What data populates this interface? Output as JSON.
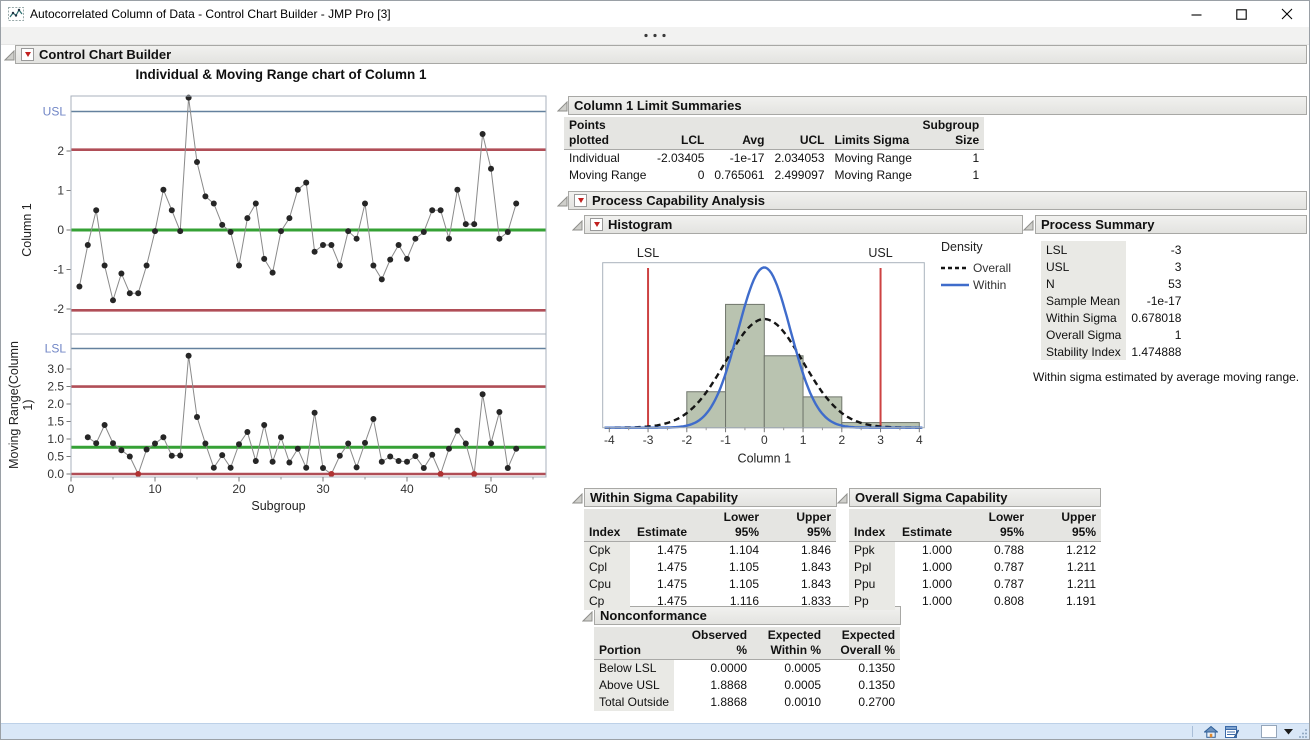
{
  "window": {
    "title": "Autocorrelated Column of Data - Control Chart Builder - JMP Pro [3]"
  },
  "toolbar": {
    "overflow_icon": "ellipsis-dots"
  },
  "outlines": {
    "control_chart_builder": {
      "label": "Control Chart Builder",
      "red_triangle": true
    },
    "limit_summaries": {
      "label": "Column 1 Limit Summaries",
      "red_triangle": false
    },
    "process_capability": {
      "label": "Process Capability Analysis",
      "red_triangle": true
    },
    "histogram": {
      "label": "Histogram",
      "red_triangle": true
    },
    "process_summary": {
      "label": "Process Summary",
      "red_triangle": false
    },
    "within_sigma": {
      "label": "Within Sigma Capability",
      "red_triangle": false
    },
    "overall_sigma": {
      "label": "Overall Sigma Capability",
      "red_triangle": false
    },
    "nonconformance": {
      "label": "Nonconformance",
      "red_triangle": false
    }
  },
  "colors": {
    "center_line_green": "#35a135",
    "control_limit_red": "#b04e57",
    "spec_line_blue": "#64819e",
    "spec_label_blue": "#7186c6",
    "spec_line_red": "#cd4242",
    "point_black": "#262626",
    "out_of_limit_red": "#b03232",
    "connect_gray": "#8a8a8a",
    "within_curve_blue": "#3f6ccb",
    "overall_curve_black": "#151515",
    "bar_fill": "#b9c3b0",
    "bar_stroke": "#70766c",
    "frame_gray": "#a9b2bc",
    "tick_text": "#333333",
    "statusbar_bg": "#d9e7f7"
  },
  "chart_data": [
    {
      "type": "line",
      "name": "individual-control-chart",
      "title": "Individual & Moving Range chart of Column 1",
      "ylabel": "Column 1",
      "xlabel": "Subgroup",
      "x_ticks": [
        0,
        10,
        20,
        30,
        40,
        50
      ],
      "x_minor_ticks": [
        5,
        15,
        25,
        35,
        45,
        55
      ],
      "y_ticks": [
        2,
        1,
        0,
        -1,
        -2
      ],
      "y_range": [
        -2.63,
        3.39
      ],
      "x_range": [
        0,
        56.5
      ],
      "reference_lines": {
        "USL": 3,
        "UCL": 2.034053,
        "Avg": 0,
        "LCL": -2.03405,
        "LSL": -3
      },
      "x_start": 1,
      "values": [
        -1.43,
        -0.38,
        0.5,
        -0.9,
        -1.78,
        -1.1,
        -1.6,
        -1.6,
        -0.9,
        -0.03,
        1.02,
        0.5,
        -0.03,
        3.35,
        1.72,
        0.85,
        0.67,
        0.13,
        -0.05,
        -0.9,
        0.3,
        0.67,
        -0.73,
        -1.08,
        -0.03,
        0.3,
        1.02,
        1.2,
        -0.55,
        -0.38,
        -0.38,
        -0.9,
        -0.03,
        -0.22,
        0.67,
        -0.9,
        -1.25,
        -0.75,
        -0.38,
        -0.73,
        -0.22,
        -0.05,
        0.5,
        0.5,
        -0.22,
        1.02,
        0.15,
        0.15,
        2.43,
        1.55,
        -0.22,
        -0.05,
        0.67
      ]
    },
    {
      "type": "line",
      "name": "moving-range-chart",
      "ylabel": "Moving Range(Column 1)",
      "ylabel_lines": [
        "Moving Range(Column",
        "1)"
      ],
      "y_ticks": [
        3.0,
        2.5,
        2.0,
        1.5,
        1.0,
        0.5,
        0.0
      ],
      "y_range": [
        -0.09,
        4.0
      ],
      "reference_lines": {
        "UCL": 2.499097,
        "Avg": 0.765061,
        "LCL": 0
      },
      "x_start": 2,
      "values": [
        1.05,
        0.88,
        1.4,
        0.88,
        0.68,
        0.5,
        0,
        0.7,
        0.87,
        1.05,
        0.52,
        0.53,
        3.38,
        1.63,
        0.87,
        0.18,
        0.54,
        0.18,
        0.85,
        1.2,
        0.37,
        1.4,
        0.35,
        1.05,
        0.33,
        0.72,
        0.18,
        1.75,
        0.17,
        0,
        0.52,
        0.87,
        0.19,
        0.89,
        1.57,
        0.35,
        0.5,
        0.37,
        0.35,
        0.51,
        0.17,
        0.55,
        0,
        0.72,
        1.24,
        0.87,
        0,
        2.28,
        0.88,
        1.77,
        0.17,
        0.72
      ],
      "out_of_limit_values": [
        0
      ]
    },
    {
      "type": "histogram",
      "name": "capability-histogram",
      "xlabel": "Column 1",
      "x_ticks": [
        -4,
        -3,
        -2,
        -1,
        0,
        1,
        2,
        3,
        4
      ],
      "x_range": [
        -4.17,
        4.13
      ],
      "bin_edges": [
        -2,
        -1,
        0,
        1,
        2,
        3,
        4
      ],
      "bin_counts": [
        7,
        24,
        14,
        6,
        1,
        1
      ],
      "n": 53,
      "spec_limits": {
        "LSL": -3,
        "USL": 3
      },
      "spec_labels": [
        "LSL",
        "USL"
      ],
      "density_curves": [
        {
          "name": "Overall",
          "mean": 0,
          "sigma": 1,
          "style": "dashed"
        },
        {
          "name": "Within",
          "mean": 0,
          "sigma": 0.678018,
          "style": "solid"
        }
      ],
      "legend": {
        "title": "Density",
        "entries": [
          "Overall",
          "Within"
        ],
        "position": "right"
      }
    }
  ],
  "tables": {
    "limit_summaries": {
      "headers": [
        "Points\nplotted",
        "LCL",
        "Avg",
        "UCL",
        "Limits Sigma",
        "Subgroup\nSize"
      ],
      "aligns": [
        "left",
        "right",
        "right",
        "right",
        "left",
        "right"
      ],
      "widths": [
        88,
        54,
        58,
        58,
        88,
        62
      ],
      "first_col_gray": false,
      "rows": [
        [
          "Individual",
          "-2.03405",
          "-1e-17",
          "2.034053",
          "Moving Range",
          "1"
        ],
        [
          "Moving Range",
          "0",
          "0.765061",
          "2.499097",
          "Moving Range",
          "1"
        ]
      ]
    },
    "process_summary": {
      "aligns": [
        "left",
        "right"
      ],
      "widths": [
        84,
        58
      ],
      "first_col_gray": true,
      "rows": [
        [
          "LSL",
          "-3"
        ],
        [
          "USL",
          "3"
        ],
        [
          "N",
          "53"
        ],
        [
          "Sample Mean",
          "-1e-17"
        ],
        [
          "Within Sigma",
          "0.678018"
        ],
        [
          "Overall Sigma",
          "1"
        ],
        [
          "Stability Index",
          "1.474888"
        ]
      ],
      "note": "Within sigma estimated by average moving range."
    },
    "within_sigma": {
      "headers": [
        "Index",
        "Estimate",
        "Lower 95%",
        "Upper 95%"
      ],
      "aligns": [
        "left",
        "right",
        "right",
        "right"
      ],
      "widths": [
        46,
        62,
        72,
        72
      ],
      "first_col_gray": true,
      "rows": [
        [
          "Cpk",
          "1.475",
          "1.104",
          "1.846"
        ],
        [
          "Cpl",
          "1.475",
          "1.105",
          "1.843"
        ],
        [
          "Cpu",
          "1.475",
          "1.105",
          "1.843"
        ],
        [
          "Cp",
          "1.475",
          "1.116",
          "1.833"
        ]
      ]
    },
    "overall_sigma": {
      "headers": [
        "Index",
        "Estimate",
        "Lower 95%",
        "Upper 95%"
      ],
      "aligns": [
        "left",
        "right",
        "right",
        "right"
      ],
      "widths": [
        46,
        62,
        72,
        72
      ],
      "first_col_gray": true,
      "rows": [
        [
          "Ppk",
          "1.000",
          "0.788",
          "1.212"
        ],
        [
          "Ppl",
          "1.000",
          "0.787",
          "1.211"
        ],
        [
          "Ppu",
          "1.000",
          "0.787",
          "1.211"
        ],
        [
          "Pp",
          "1.000",
          "0.808",
          "1.191"
        ]
      ]
    },
    "nonconformance": {
      "headers": [
        "Portion",
        "Observed %",
        "Expected\nWithin %",
        "Expected\nOverall %"
      ],
      "aligns": [
        "left",
        "right",
        "right",
        "right"
      ],
      "widths": [
        80,
        78,
        74,
        74
      ],
      "first_col_gray": true,
      "rows": [
        [
          "Below LSL",
          "0.0000",
          "0.0005",
          "0.1350"
        ],
        [
          "Above USL",
          "1.8868",
          "0.0005",
          "0.1350"
        ],
        [
          "Total Outside",
          "1.8868",
          "0.0010",
          "0.2700"
        ]
      ]
    }
  },
  "statusbar": {
    "icons": [
      "home-icon",
      "window-list-icon",
      "empty-box-icon",
      "dropdown-arrow-icon"
    ]
  }
}
